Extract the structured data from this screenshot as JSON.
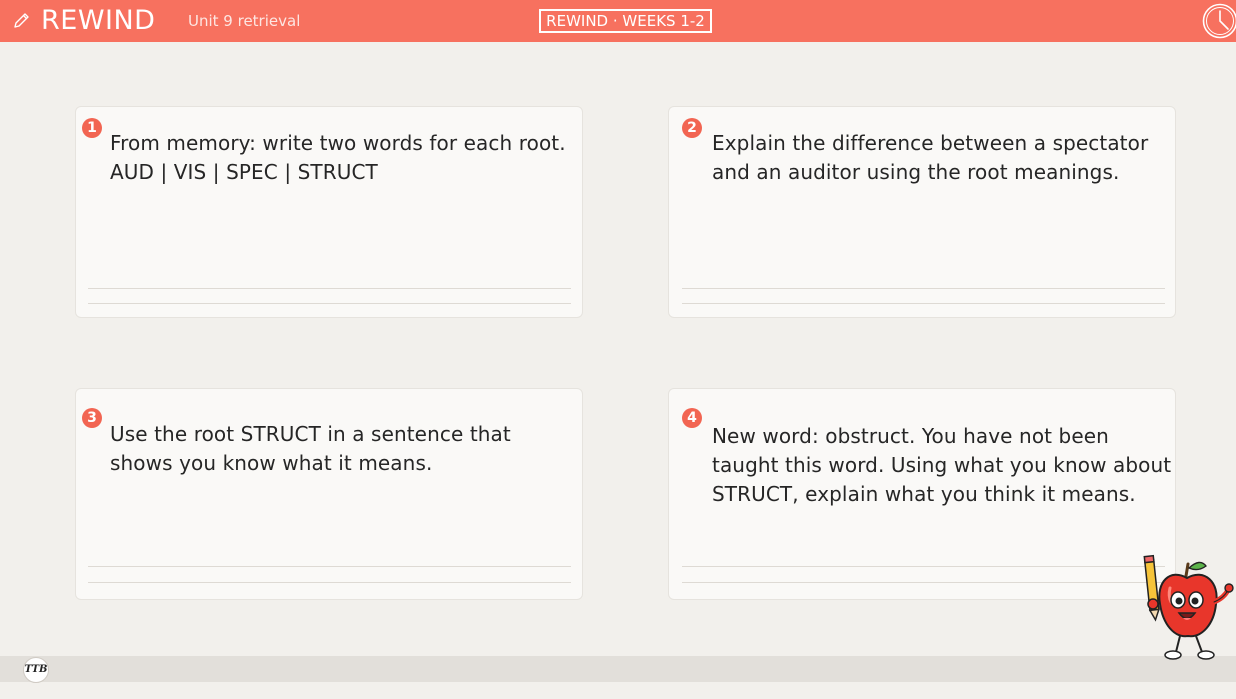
{
  "header": {
    "brand": "REWIND",
    "unit": "Unit 9 retrieval",
    "badge": "REWIND · WEEKS 1-2"
  },
  "questions": [
    {
      "number": "1",
      "text": "From memory: write two words for each root. AUD | VIS | SPEC | STRUCT"
    },
    {
      "number": "2",
      "text": "Explain the difference between a spectator and an auditor using the root meanings."
    },
    {
      "number": "3",
      "text": "Use the root STRUCT in a sentence that shows you know what it means."
    },
    {
      "number": "4",
      "text": "New word: obstruct. You have not been taught this word. Using what you know about STRUCT, explain what you think it means."
    }
  ],
  "footer": {
    "logo": "TTB"
  },
  "colors": {
    "accent": "#f7715f",
    "number_badge": "#f26552",
    "background": "#f2f0ec"
  },
  "icons": {
    "left": "pencil-icon",
    "right": "clock-icon",
    "mascot": "apple-mascot-with-pencil"
  }
}
